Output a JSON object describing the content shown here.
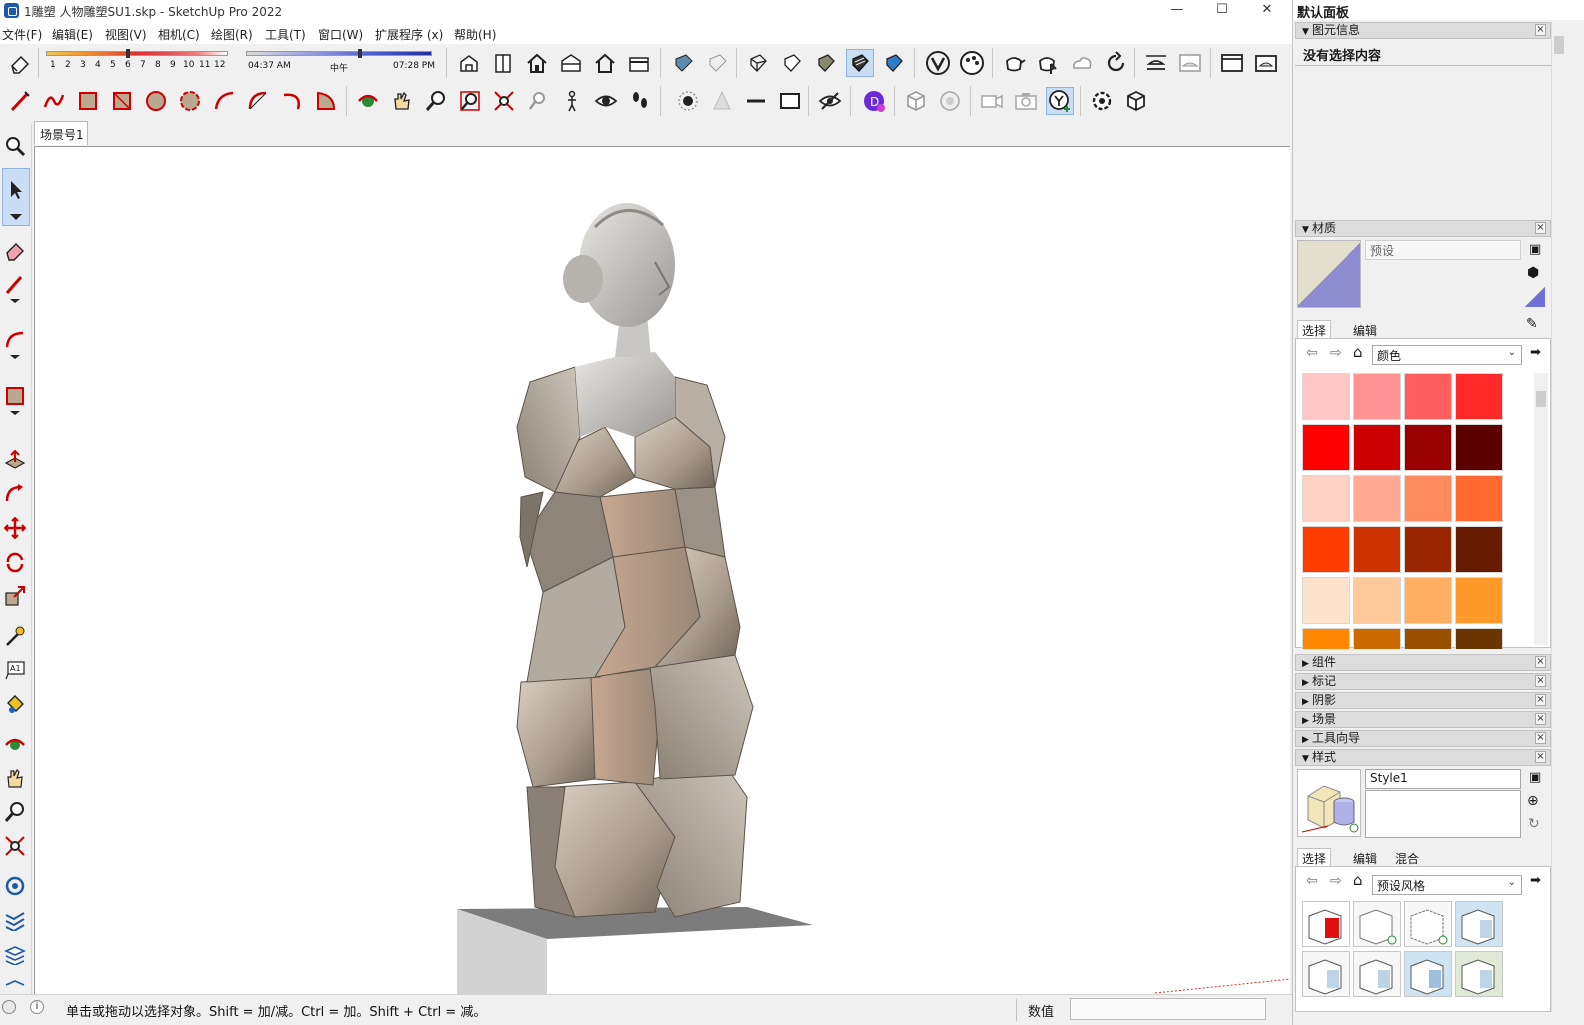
{
  "window": {
    "title": "1雕塑 人物雕塑SU1.skp - SketchUp Pro 2022",
    "minimize": "—",
    "maximize": "☐",
    "close": "✕"
  },
  "menu": [
    "文件(F)",
    "编辑(E)",
    "视图(V)",
    "相机(C)",
    "绘图(R)",
    "工具(T)",
    "窗口(W)",
    "扩展程序 (x)",
    "帮助(H)"
  ],
  "shadow_settings": {
    "months": [
      "1",
      "2",
      "3",
      "4",
      "5",
      "6",
      "7",
      "8",
      "9",
      "10",
      "11",
      "12"
    ],
    "time_start": "04:37 AM",
    "time_mid": "中午",
    "time_end": "07:28 PM"
  },
  "scene_tab": "场景号1",
  "statusbar": {
    "message": "单击或拖动以选择对象。Shift = 加/减。Ctrl = 加。Shift + Ctrl = 减。",
    "value_label": "数值",
    "value": ""
  },
  "panel": {
    "title": "默认面板",
    "entity_info": {
      "header": "图元信息",
      "text": "没有选择内容"
    },
    "materials": {
      "header": "材质",
      "name": "预设",
      "tabs": [
        "选择",
        "编辑"
      ],
      "collection": "颜色",
      "swatches": [
        "#ffc6c6",
        "#ff9393",
        "#ff5e5e",
        "#ff2b2b",
        "#ff0000",
        "#cc0000",
        "#990000",
        "#5c0000",
        "#ffd0c4",
        "#ffaa90",
        "#ff8a5e",
        "#ff6a30",
        "#ff3d00",
        "#cc3300",
        "#992600",
        "#661a00",
        "#ffe2cc",
        "#ffc99a",
        "#ffae62",
        "#ff9a2a",
        "#ff8800",
        "#cc6a00",
        "#994e00",
        "#6b3500"
      ]
    },
    "collapsed_trays": [
      "组件",
      "标记",
      "阴影",
      "场景",
      "工具向导"
    ],
    "styles": {
      "header": "样式",
      "name": "Style1",
      "description": "",
      "tabs": [
        "选择",
        "编辑",
        "混合"
      ],
      "collection": "预设风格"
    }
  },
  "colors": {
    "selected_tool_bg": "#c9def5",
    "viewport_bg": "#ffffff",
    "pedestal_top": "#7c7c7c",
    "pedestal_side": "#d2d2d2"
  }
}
